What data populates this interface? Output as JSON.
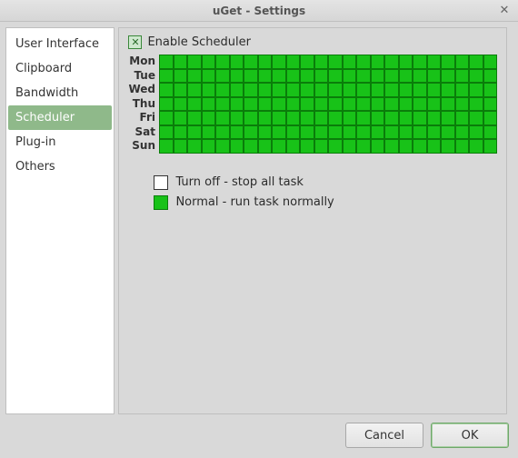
{
  "window": {
    "title": "uGet - Settings"
  },
  "sidebar": {
    "items": [
      {
        "label": "User Interface",
        "selected": false
      },
      {
        "label": "Clipboard",
        "selected": false
      },
      {
        "label": "Bandwidth",
        "selected": false
      },
      {
        "label": "Scheduler",
        "selected": true
      },
      {
        "label": "Plug-in",
        "selected": false
      },
      {
        "label": "Others",
        "selected": false
      }
    ]
  },
  "scheduler": {
    "enable_label": "Enable Scheduler",
    "enable_checked": true,
    "days": [
      "Mon",
      "Tue",
      "Wed",
      "Thu",
      "Fri",
      "Sat",
      "Sun"
    ],
    "columns": 24,
    "legend": {
      "off": "Turn off - stop all task",
      "normal": "Normal  - run task normally"
    }
  },
  "buttons": {
    "cancel": "Cancel",
    "ok": "OK"
  }
}
